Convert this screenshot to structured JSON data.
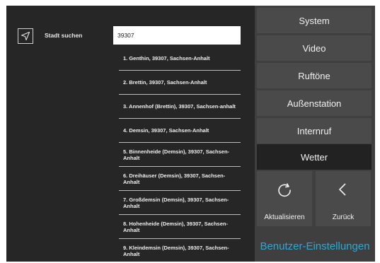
{
  "search": {
    "label": "Stadt suchen",
    "value": "39307",
    "icon": "location-arrow-icon"
  },
  "results": [
    "1. Genthin, 39307, Sachsen-Anhalt",
    "2. Brettin, 39307, Sachsen-Anhalt",
    "3. Annenhof (Brettin), 39307, Sachsen-anhalt",
    "4. Demsin, 39307, Sachsen-Anhalt",
    "5. Binnenheide (Demsin), 39307, Sachsen-Anhalt",
    "6. Dreihäuser (Demsin), 39307, Sachsen-Anhalt",
    "7. Großdemsin (Demsin), 39307, Sachsen-Anhalt",
    "8. Hohenheide (Demsin), 39307, Sachsen-Anhalt",
    "9. Kleindemsin (Demsin), 39307, Sachsen-Anhalt"
  ],
  "menu": {
    "system": "System",
    "video": "Video",
    "ringtones": "Ruftöne",
    "outdoor_station": "Außenstation",
    "intercom": "Internruf",
    "weather": "Wetter",
    "active": "Wetter"
  },
  "actions": {
    "refresh_label": "Aktualisieren",
    "refresh_icon": "refresh-icon",
    "back_label": "Zurück",
    "back_icon": "chevron-left-icon"
  },
  "footer": {
    "user_settings": "Benutzer-Einstellungen"
  },
  "colors": {
    "background": "#262626",
    "panel": "#3f3f3f",
    "button": "#4a4a4a",
    "active_button": "#222222",
    "accent": "#29a9d9"
  }
}
